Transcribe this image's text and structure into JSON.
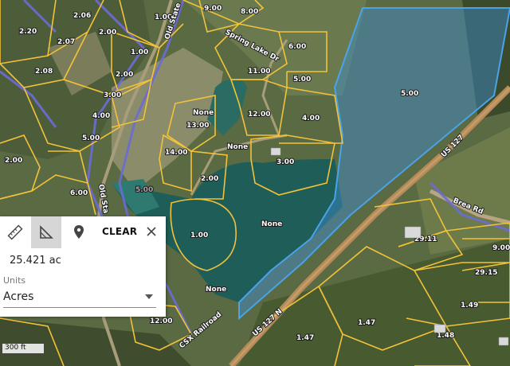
{
  "map": {
    "parcel_labels": [
      "2.06",
      "9.00",
      "8.00",
      "2.20",
      "2.07",
      "1.00",
      "2.00",
      "1.00",
      "6.00",
      "2.08",
      "2.00",
      "11.00",
      "5.00",
      "3.00",
      "4.00",
      "None",
      "12.00",
      "4.00",
      "5.00",
      "5.00",
      "13.00",
      "14.00",
      "None",
      "3.00",
      "2.00",
      "2.00",
      "6.00",
      "5.00",
      "1.00",
      "None",
      "None",
      "12.00",
      "29.11",
      "29.15",
      "1.49",
      "1.47",
      "1.47",
      "1.48",
      "9.00"
    ],
    "road_labels": [
      "Old State",
      "Spring Lake Dr",
      "Old Sta",
      "US 127",
      "Brea Rd",
      "US 127 N",
      "CSX Railroad"
    ],
    "colors": {
      "parcel_line": "#f2c23a",
      "district_line": "#6b6bd6",
      "selection_fill": "#3d8fd4",
      "selection_line": "#4aa3e8",
      "water": "#1f5e58"
    }
  },
  "measure_panel": {
    "tools": [
      {
        "name": "distance",
        "icon": "ruler-icon"
      },
      {
        "name": "area",
        "icon": "area-measure-icon"
      },
      {
        "name": "location",
        "icon": "location-pin-icon"
      }
    ],
    "active_tool": "area",
    "clear_label": "CLEAR",
    "close_icon": "close-icon",
    "result": "25.421 ac",
    "units_label": "Units",
    "units_value": "Acres"
  },
  "scale_bar": {
    "label": "300 ft"
  }
}
